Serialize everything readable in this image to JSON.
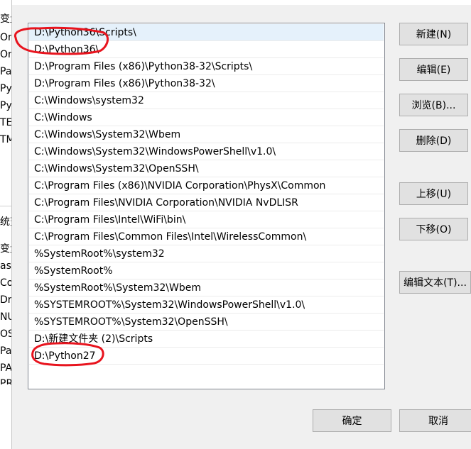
{
  "background_window": {
    "labels": [
      "变量",
      "On",
      "On",
      "Pa",
      "Py",
      "Py",
      "TE",
      "TM",
      "统变",
      "变量",
      "asl",
      "Co",
      "Dr",
      "NU",
      "OS",
      "Pa",
      "PA",
      "PR"
    ]
  },
  "path_list": {
    "items": [
      "D:\\Python36\\Scripts\\",
      "D:\\Python36\\",
      "D:\\Program Files (x86)\\Python38-32\\Scripts\\",
      "D:\\Program Files (x86)\\Python38-32\\",
      "C:\\Windows\\system32",
      "C:\\Windows",
      "C:\\Windows\\System32\\Wbem",
      "C:\\Windows\\System32\\WindowsPowerShell\\v1.0\\",
      "C:\\Windows\\System32\\OpenSSH\\",
      "C:\\Program Files (x86)\\NVIDIA Corporation\\PhysX\\Common",
      "C:\\Program Files\\NVIDIA Corporation\\NVIDIA NvDLISR",
      "C:\\Program Files\\Intel\\WiFi\\bin\\",
      "C:\\Program Files\\Common Files\\Intel\\WirelessCommon\\",
      "%SystemRoot%\\system32",
      "%SystemRoot%",
      "%SystemRoot%\\System32\\Wbem",
      "%SYSTEMROOT%\\System32\\WindowsPowerShell\\v1.0\\",
      "%SYSTEMROOT%\\System32\\OpenSSH\\",
      "D:\\新建文件夹 (2)\\Scripts",
      "D:\\Python27"
    ],
    "selected_index": 0
  },
  "buttons": {
    "new": "新建(N)",
    "edit": "编辑(E)",
    "browse": "浏览(B)...",
    "delete": "删除(D)",
    "move_up": "上移(U)",
    "move_down": "下移(O)",
    "edit_text": "编辑文本(T)...",
    "ok": "确定",
    "cancel": "取消"
  },
  "colors": {
    "annotation": "#e8141e",
    "selection": "#e5f1fb"
  }
}
